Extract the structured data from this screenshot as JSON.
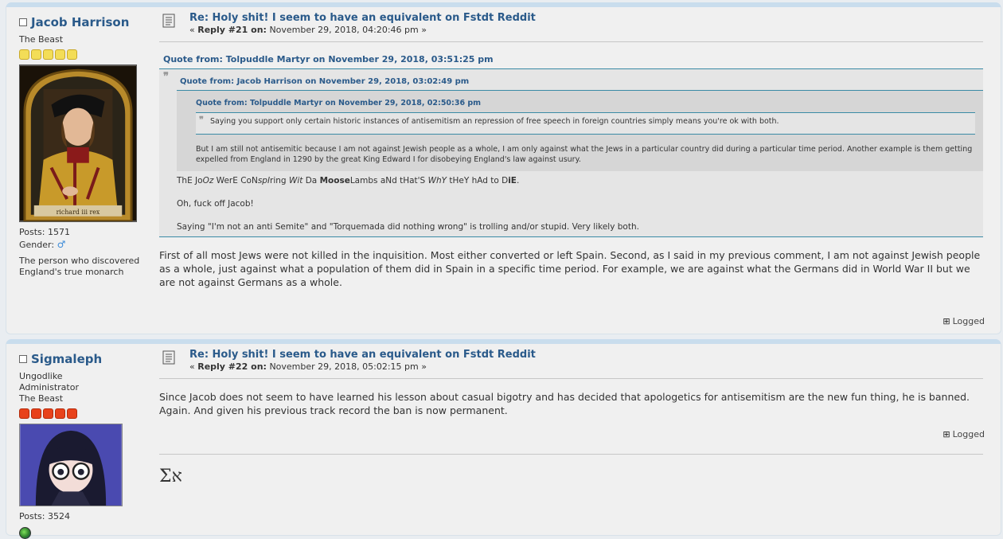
{
  "posts": [
    {
      "poster": {
        "name": "Jacob Harrison",
        "title": "The Beast",
        "posts_label": "Posts: 1571",
        "gender_label": "Gender:",
        "gender_symbol": "♂",
        "blurb": "The person who discovered England's true monarch",
        "avatar_caption": "richard     iii     rex"
      },
      "subject": "Re: Holy shit! I seem to have an equivalent on Fstdt Reddit",
      "reply_prefix": "« ",
      "reply_label": "Reply #21 on:",
      "reply_date": " November 29, 2018, 04:20:46 pm »",
      "quote_outer": {
        "header": "Quote from: Tolpuddle Martyr on November 29, 2018, 03:51:25 pm",
        "quote_mid": {
          "header": "Quote from: Jacob Harrison on November 29, 2018, 03:02:49 pm",
          "quote_inner": {
            "header": "Quote from: Tolpuddle Martyr on November 29, 2018, 02:50:36 pm",
            "text": "Saying you support only certain historic instances of antisemitism an repression of free speech in foreign countries simply means you're ok with both."
          },
          "text": "But I am still not antisemitic because I am not against Jewish people as a whole, I am only against what the Jews in a particular country did during a particular time period. Another example is them getting expelled from England in 1290 by the great King Edward I for disobeying England's law against usury."
        },
        "line1": {
          "a": "ThE Jo",
          "b": "Oz",
          "c": " WerE CoN",
          "d": "spI",
          "e": "ring ",
          "f": "Wit",
          "g": " Da ",
          "h": "Moose",
          "i": "Lambs aNd tHat'S ",
          "j": "WhY",
          "k": " tHeY hAd to D",
          "l": "iE",
          "m": "."
        },
        "line2": "Oh, fuck off Jacob!",
        "line3": "Saying \"I'm not an anti Semite\" and \"Torquemada did nothing wrong\" is trolling and/or stupid. Very likely both."
      },
      "body": "First of all most Jews were not killed in the inquisition. Most either converted or left Spain. Second, as I said in my previous comment, I am not against Jewish people as a whole, just against what a population of them did in Spain in a specific time period. For example, we are against what the Germans did in World War II but we are not against Germans as a whole.",
      "logged": "Logged"
    },
    {
      "poster": {
        "name": "Sigmaleph",
        "title1": "Ungodlike",
        "title2": "Administrator",
        "title3": "The Beast",
        "posts_label": "Posts: 3524"
      },
      "subject": "Re: Holy shit! I seem to have an equivalent on Fstdt Reddit",
      "reply_prefix": "« ",
      "reply_label": "Reply #22 on:",
      "reply_date": " November 29, 2018, 05:02:15 pm »",
      "body": "Since Jacob does not seem to have learned his lesson about casual bigotry and has decided that apologetics for antisemitism are the new fun thing, he is banned. Again. And given his previous track record the ban is now permanent.",
      "logged": "Logged",
      "signature": "Σא"
    }
  ]
}
